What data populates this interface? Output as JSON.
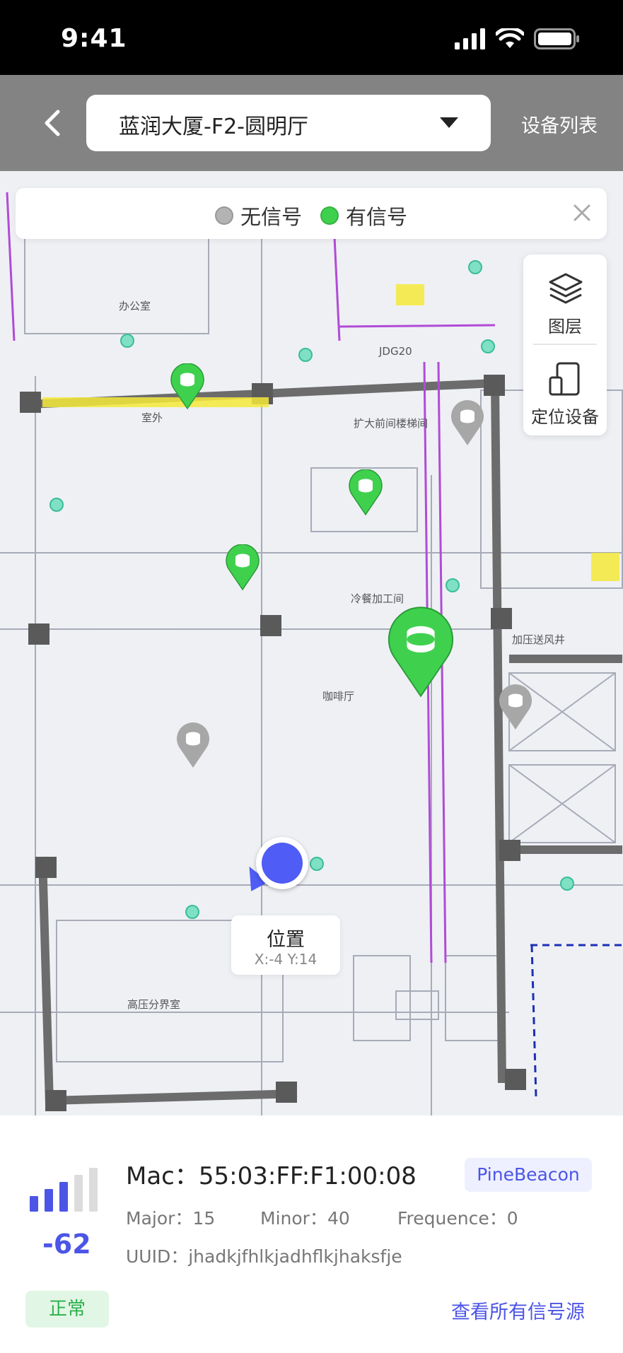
{
  "status_bar": {
    "time": "9:41"
  },
  "nav": {
    "back_icon": "chevron-left-icon",
    "venue": "蓝润大厦-F2-圆明厅",
    "device_list": "设备列表"
  },
  "legend": {
    "items": [
      {
        "label": "无信号",
        "color": "#b3b3b3"
      },
      {
        "label": "有信号",
        "color": "#3fd14e"
      }
    ],
    "close_icon": "close-icon"
  },
  "tools": {
    "layers": {
      "label": "图层",
      "icon": "layers-icon"
    },
    "locate_device": {
      "label": "定位设备",
      "icon": "device-locate-icon"
    }
  },
  "map": {
    "background": "#eef0f4",
    "active_color": "#3fd14e",
    "inactive_color": "#a7a7a7",
    "room_labels": [
      "办公室",
      "室外",
      "冷餐加工间",
      "咖啡厅",
      "高压分界室",
      "扩大前间楼梯间",
      "加压送风井",
      "JDG20"
    ],
    "location": {
      "title": "位置",
      "coords": "X:-4 Y:14",
      "color": "#4f5cf5"
    }
  },
  "device": {
    "signal_level": 3,
    "signal_max": 5,
    "rssi": "-62",
    "mac_label": "Mac：",
    "mac": "55:03:FF:F1:00:08",
    "brand": "PineBeacon",
    "major_label": "Major：",
    "major": "15",
    "minor_label": "Minor：",
    "minor": "40",
    "frequence_label": "Frequence：",
    "frequence": "0",
    "uuid_label": "UUID：",
    "uuid": "jhadkjfhlkjadhflkjhaksfje",
    "status": "正常",
    "status_color": "#2bb04a",
    "view_all": "查看所有信号源"
  }
}
